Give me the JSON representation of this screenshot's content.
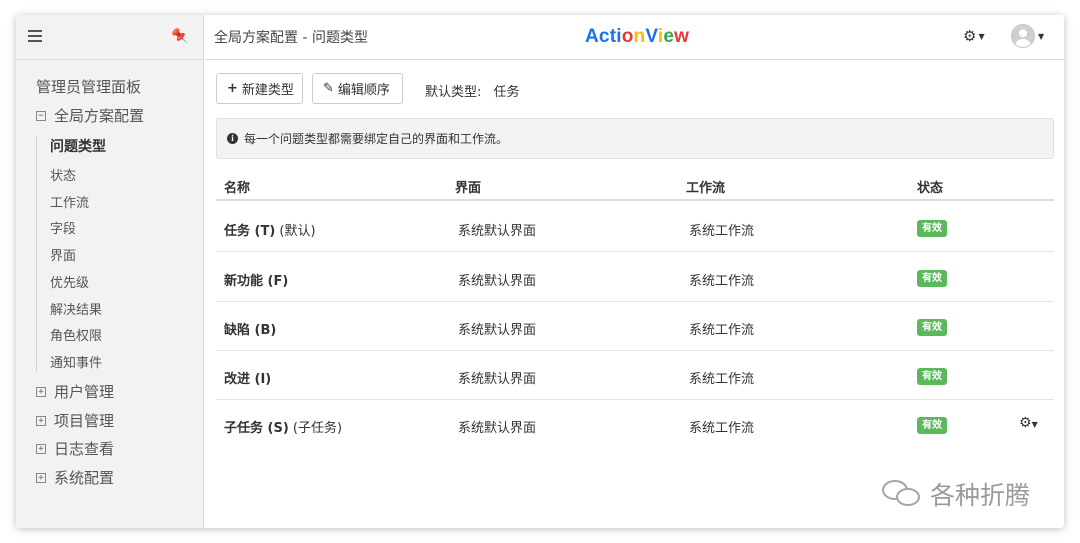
{
  "sidebar": {
    "admin_title": "管理员管理面板",
    "groups": [
      {
        "label": "全局方案配置",
        "toggle": "⊟"
      },
      {
        "label": "用户管理",
        "toggle": "⊞"
      },
      {
        "label": "项目管理",
        "toggle": "⊞"
      },
      {
        "label": "日志查看",
        "toggle": "⊞"
      },
      {
        "label": "系统配置",
        "toggle": "⊞"
      }
    ],
    "subitems": [
      "问题类型",
      "状态",
      "工作流",
      "字段",
      "界面",
      "优先级",
      "解决结果",
      "角色权限",
      "通知事件"
    ]
  },
  "header": {
    "breadcrumb": "全局方案配置 - 问题类型",
    "logo_letters": [
      "A",
      "c",
      "t",
      "i",
      "o",
      "n",
      "V",
      "i",
      "e",
      "w"
    ],
    "logo_colors": [
      "#1a73e8",
      "#1a73e8",
      "#1a73e8",
      "#1a73e8",
      "#e53935",
      "#fbbc05",
      "#1a73e8",
      "#fbbc05",
      "#34a853",
      "#e53935"
    ]
  },
  "toolbar": {
    "new_type_icon": "+",
    "new_type_label": "新建类型",
    "edit_order_icon": "✎",
    "edit_order_label": "编辑顺序",
    "default_type_label": "默认类型:",
    "default_type_value": "任务"
  },
  "alert": {
    "icon": "info-icon",
    "text": "每一个问题类型都需要绑定自己的界面和工作流。"
  },
  "table": {
    "headers": [
      "名称",
      "界面",
      "工作流",
      "状态"
    ],
    "rows": [
      {
        "name": "任务 (T)",
        "suffix": " (默认)",
        "screen": "系统默认界面",
        "workflow": "系统工作流",
        "status": "有效"
      },
      {
        "name": "新功能 (F)",
        "suffix": "",
        "screen": "系统默认界面",
        "workflow": "系统工作流",
        "status": "有效"
      },
      {
        "name": "缺陷 (B)",
        "suffix": "",
        "screen": "系统默认界面",
        "workflow": "系统工作流",
        "status": "有效"
      },
      {
        "name": "改进 (I)",
        "suffix": "",
        "screen": "系统默认界面",
        "workflow": "系统工作流",
        "status": "有效"
      },
      {
        "name": "子任务 (S)",
        "suffix": " (子任务)",
        "screen": "系统默认界面",
        "workflow": "系统工作流",
        "status": "有效"
      }
    ]
  },
  "colors": {
    "status_active": "#5cb85c",
    "sidebar_bg": "#f2f2f2"
  },
  "watermark": {
    "text": "各种折腾"
  }
}
